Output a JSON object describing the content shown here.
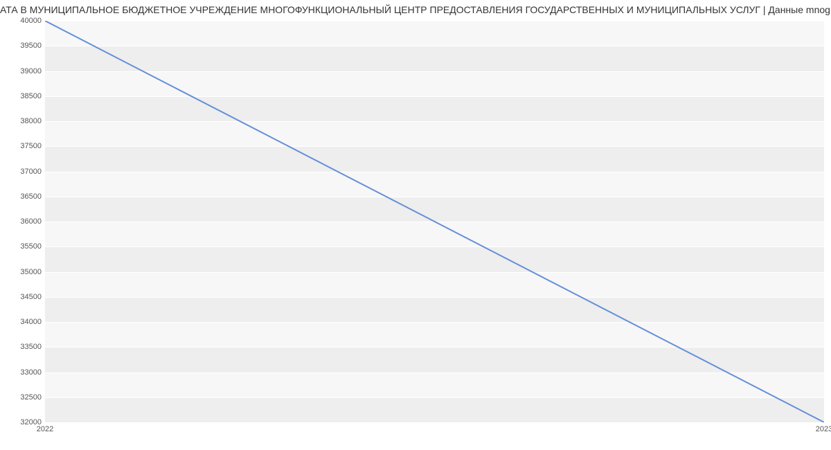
{
  "chart_data": {
    "type": "line",
    "title": "АТА В МУНИЦИПАЛЬНОЕ БЮДЖЕТНОЕ УЧРЕЖДЕНИЕ МНОГОФУНКЦИОНАЛЬНЫЙ ЦЕНТР ПРЕДОСТАВЛЕНИЯ ГОСУДАРСТВЕННЫХ И МУНИЦИПАЛЬНЫХ УСЛУГ | Данные mnog",
    "x": [
      2022,
      2023
    ],
    "values": [
      40000,
      32000
    ],
    "xlabel": "",
    "ylabel": "",
    "ylim": [
      32000,
      40000
    ],
    "y_ticks": [
      32000,
      32500,
      33000,
      33500,
      34000,
      34500,
      35000,
      35500,
      36000,
      36500,
      37000,
      37500,
      38000,
      38500,
      39000,
      39500,
      40000
    ],
    "x_ticks": [
      2022,
      2023
    ],
    "line_color": "#648fd8"
  }
}
